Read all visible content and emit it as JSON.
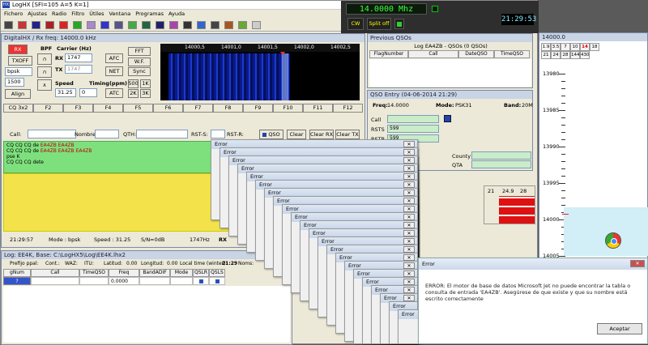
{
  "app": {
    "title": "LogHX [SFI=105 A=5 K=1]",
    "menu": [
      "Fichero",
      "Ajustes",
      "Radio",
      "Filtro",
      "Útiles",
      "Ventana",
      "Programas",
      "Ayuda"
    ]
  },
  "radio": {
    "frequency": "14.0000 Mhz",
    "cw_label": "CW",
    "split_label": "Split off",
    "clock": "21:29:53"
  },
  "digital": {
    "title": "DigitalHX / Rx freq: 14000.0 kHz",
    "rx_button": "RX",
    "txoff_button": "TXOFF",
    "mode_select": "bpsk",
    "speed_select": "1500",
    "align_button": "Align",
    "bpf_label": "BPF",
    "carrier_label": "Carrier (Hz)",
    "rx_label": "RX",
    "tx_label": "TX",
    "rx_carrier": "1747",
    "tx_carrier": "1747",
    "afc_button": "AFC",
    "net_button": "NET",
    "speed_label": "Speed",
    "timing_label": "Timing(ppm)",
    "speed_value": "31.25",
    "timing_value": "0",
    "atc_button": "ATC",
    "fft_button": "FFT",
    "wf_button": "W.F.",
    "sync_button": "Sync",
    "speed_buttons": [
      "500",
      "1K",
      "2K",
      "3K"
    ],
    "waterfall_ticks": [
      "14000,5",
      "14001,0",
      "14001,5",
      "14002,0",
      "14002,5"
    ],
    "macros": [
      "CQ 3x2",
      "F2",
      "F3",
      "F4",
      "F5",
      "F6",
      "F7",
      "F8",
      "F9",
      "F10",
      "F11",
      "F12"
    ],
    "call_label": "Call:",
    "name_label": "Nombre:",
    "qth_label": "QTH:",
    "rsts_label": "RST-S:",
    "rstr_label": "RST-R:",
    "qso_button": "QSO",
    "clear_button": "Clear",
    "clear_rx_button": "Clear RX",
    "clear_tx_button": "Clear TX",
    "rx_lines": [
      {
        "pre": "CQ CQ CQ de ",
        "call": "EA4ZB EA4ZB"
      },
      {
        "pre": "CQ CQ CQ de ",
        "call": "EA4ZB EA4ZB EA4ZB"
      },
      {
        "pre": "pse K",
        "call": ""
      },
      {
        "pre": "CQ CQ CQ dete",
        "call": ""
      }
    ],
    "status": {
      "time": "21:29:57",
      "mode": "Mode : bpsk",
      "speed": "Speed : 31.25",
      "sn": "S/N=0dB",
      "hz": "1747Hz",
      "rx": "RX"
    }
  },
  "log": {
    "title": "Log: EE4K, Base: C:\\LogHX5\\Log\\EE4K.lhx2",
    "prefix_label": "Prefijo ppal:",
    "cont_label": "Cont.:",
    "waz_label": "WAZ:",
    "itu_label": "ITU:",
    "lat_label": "Latitud:",
    "lat_value": "0.00",
    "lon_label": "Longitud:",
    "lon_value": "0.00",
    "local_time_label": "Local time (winter):",
    "local_time": "21:29",
    "noms_label": "Noms:",
    "columns": [
      "gNum",
      "Call",
      "TimeQSO",
      "Freq",
      "BandADIF",
      "Mode",
      "QSLR",
      "QSLS"
    ],
    "row": {
      "num": "?",
      "freq": "0.0000"
    }
  },
  "previous": {
    "title": "Previous QSOs",
    "subtitle": "Log EA4ZB - QSOs (0 QSOs)",
    "columns": [
      "FlagNumber",
      "Call",
      "DateQSO",
      "TimeQSO"
    ]
  },
  "entry": {
    "title": "QSO Entry (04-06-2014 21:29)",
    "freq_label": "Freq:",
    "freq_value": "14.0000",
    "mode_label": "Mode:",
    "mode_value": "PSK31",
    "band_label": "Band:",
    "band_value": "20M",
    "fields": [
      {
        "label": "Call",
        "value": ""
      },
      {
        "label": "RSTS",
        "value": "599"
      },
      {
        "label": "RSTR",
        "value": "599"
      }
    ],
    "county_label": "County",
    "qta_label": "QTA"
  },
  "bandmap": {
    "title": "14000.0",
    "freqs": [
      "13980",
      "13985",
      "13990",
      "13995",
      "14000",
      "14005"
    ],
    "bands": [
      "1.9",
      "3.5",
      "7",
      "10",
      "14",
      "18",
      "21",
      "24",
      "28",
      "144",
      "430"
    ]
  },
  "cluster": {
    "numbers": [
      "21",
      "24.9",
      "28"
    ]
  },
  "errors": {
    "title": "Error",
    "count": 22
  },
  "main_error": {
    "title": "Error",
    "message": "ERROR: El motor de base de datos Microsoft Jet no puede encontrar la tabla o consulta de entrada 'EA4ZB'. Asegúrese de que existe y que su nombre está escrito correctamente",
    "ok": "Aceptar"
  }
}
